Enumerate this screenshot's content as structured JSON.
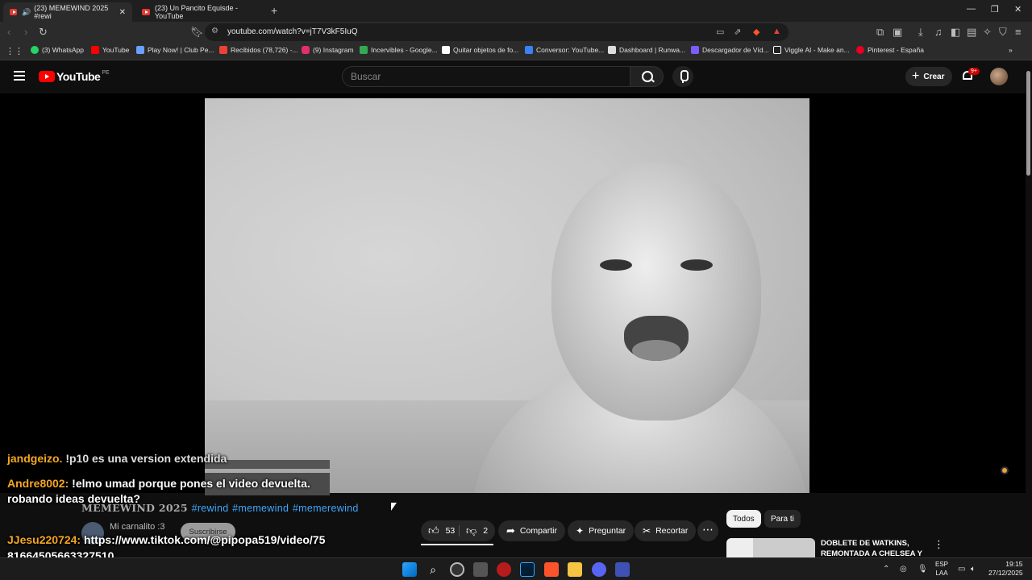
{
  "browser": {
    "tabs": [
      {
        "label": "(23) MEMEWIND 2025 #rewi",
        "active": true
      },
      {
        "label": "(23) Un Pancito Equisde - YouTube",
        "active": false
      }
    ],
    "url": "youtube.com/watch?v=jT7V3kF5IuQ",
    "bookmarks": [
      {
        "label": "(3) WhatsApp",
        "color": "#25d366"
      },
      {
        "label": "YouTube",
        "color": "#ff0000"
      },
      {
        "label": "Play Now! | Club Pe...",
        "color": "#6aa0ff"
      },
      {
        "label": "Recibidos (78,726) -...",
        "color": "#ea4335"
      },
      {
        "label": "(9) Instagram",
        "color": "#e1306c"
      },
      {
        "label": "Incervibles - Google...",
        "color": "#34a853"
      },
      {
        "label": "Quitar objetos de fo...",
        "color": "#ffffff"
      },
      {
        "label": "Conversor: YouTube...",
        "color": "#3b82f6"
      },
      {
        "label": "Dashboard | Runwa...",
        "color": "#dddddd"
      },
      {
        "label": "Descargador de Víd...",
        "color": "#7c5cff"
      },
      {
        "label": "Viggle AI - Make an...",
        "color": "#222222"
      },
      {
        "label": "Pinterest - España",
        "color": "#e60023"
      }
    ]
  },
  "youtube": {
    "logo_text": "YouTube",
    "country": "PE",
    "search_placeholder": "Buscar",
    "create_label": "Crear",
    "notif_badge": "9+"
  },
  "chat": [
    {
      "user": "jandgeizo.",
      "text": "!p10 es una version extendida",
      "cut": true
    },
    {
      "user": "Andre8002:",
      "text": "!elmo umad porque pones el video devuelta."
    },
    {
      "user": "",
      "text": "robando ideas devuelta?"
    },
    {
      "user": "JJesu220724:",
      "text": "https://www.tiktok.com/@pipopa519/video/75"
    },
    {
      "user": "",
      "text": "81664505663327510"
    }
  ],
  "video": {
    "title": "MEMEWIND 2025",
    "tags": [
      "#rewind",
      "#memewind",
      "#memerewind"
    ],
    "channel": "Mi carnalito :3",
    "subscribe_label": "Suscribirse",
    "likes": "53",
    "dislikes": "2",
    "share_label": "Compartir",
    "ask_label": "Preguntar",
    "clip_label": "Recortar"
  },
  "sidebar": {
    "chips": [
      "Todos",
      "Para ti"
    ],
    "reco_title": "DOBLETE DE WATKINS, REMONTADA A CHELSEA Y"
  },
  "taskbar": {
    "lang_top": "ESP",
    "lang_bottom": "LAA",
    "time": "19:15",
    "date": "27/12/2025"
  }
}
